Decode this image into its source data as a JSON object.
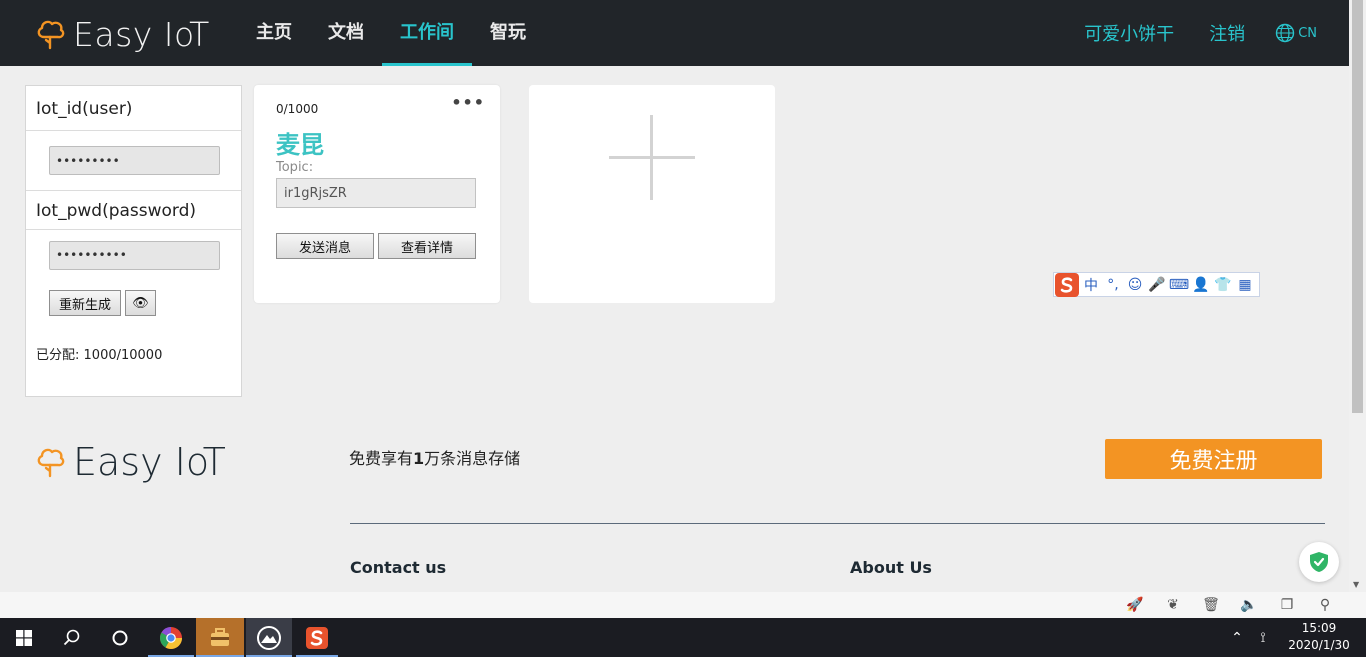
{
  "header": {
    "logo_text": "Easy IoT",
    "nav": [
      {
        "label": "主页"
      },
      {
        "label": "文档"
      },
      {
        "label": "工作间"
      },
      {
        "label": "智玩"
      }
    ],
    "active_nav": "工作间",
    "user_name": "可爱小饼干",
    "logout_label": "注销",
    "lang": "CN"
  },
  "credentials": {
    "id_label": "Iot_id(user)",
    "id_value": "•••••••••",
    "pwd_label": "Iot_pwd(password)",
    "pwd_value": "••••••••••",
    "regen_label": "重新生成",
    "eye_icon": "👁",
    "allocated_label": "已分配:",
    "allocated_value": "1000/10000"
  },
  "device_card": {
    "count": "0/1000",
    "more_icon": "•••",
    "name": "麦昆",
    "topic_label": "Topic:",
    "topic_value": "ir1gRjsZR",
    "send_label": "发送消息",
    "detail_label": "查看详情"
  },
  "ime_toolbar": {
    "items": [
      "中",
      "°,",
      "☺",
      "🎤",
      "⌨",
      "👤",
      "👕",
      "▦"
    ]
  },
  "footer": {
    "logo_text": "Easy IoT",
    "promo_pre": "免费享有",
    "promo_num": "1",
    "promo_post": "万条消息存储",
    "signup_label": "免费注册",
    "contact_label": "Contact us",
    "about_label": "About Us"
  },
  "browser_strip": {
    "icons": [
      "rocket-icon",
      "leaf-icon",
      "trash-icon",
      "sound-icon",
      "window-icon",
      "search-icon"
    ]
  },
  "taskbar": {
    "time": "15:09",
    "date": "2020/1/30"
  },
  "colors": {
    "accent": "#29c4cc",
    "header_bg": "#212529",
    "signup": "#f39423"
  }
}
